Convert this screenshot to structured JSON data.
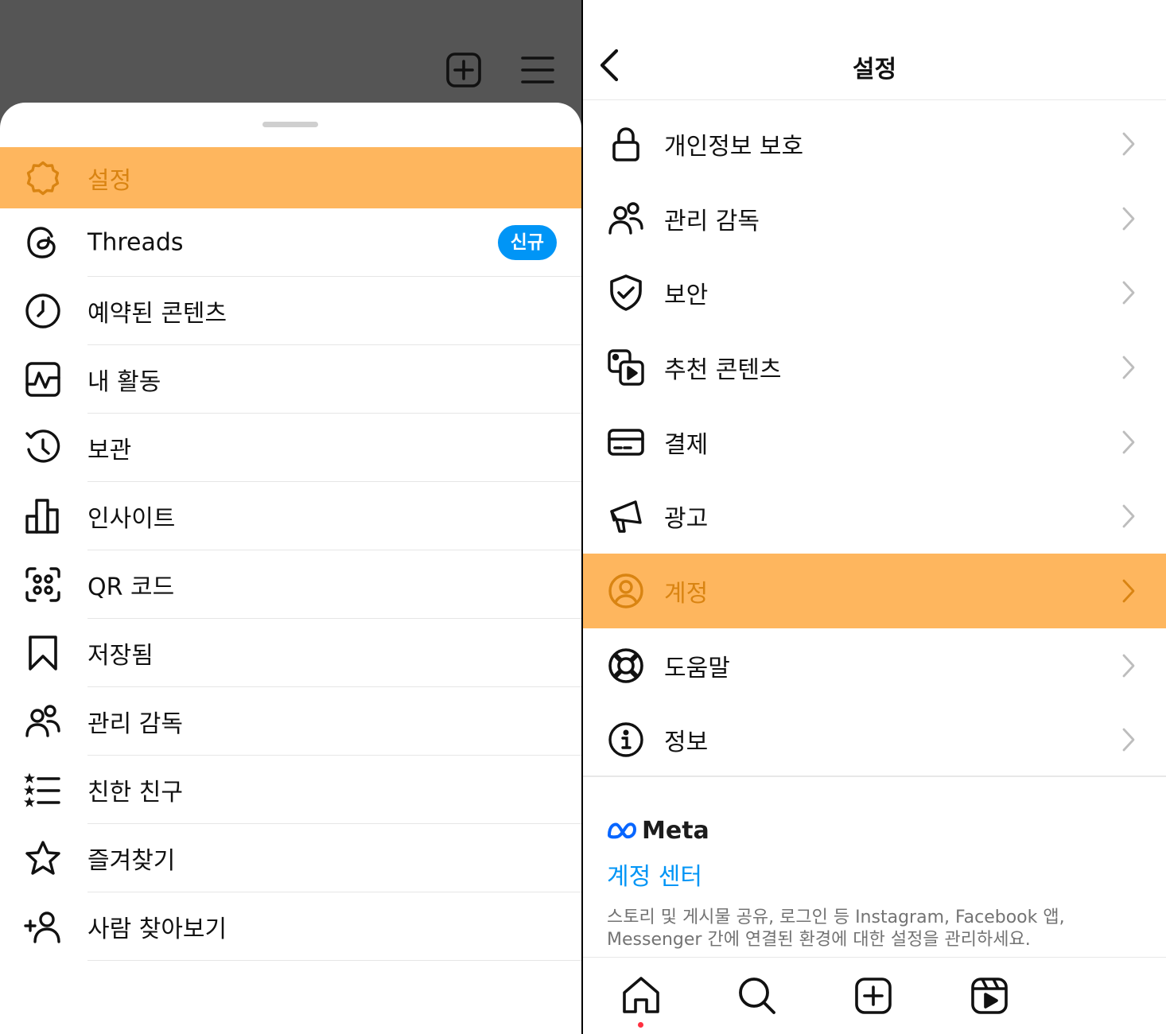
{
  "left_panel": {
    "header_icons": [
      "new-post-icon",
      "menu-icon"
    ],
    "menu": [
      {
        "label": "설정",
        "icon": "settings-icon",
        "highlighted": true
      },
      {
        "label": "Threads",
        "icon": "threads-icon",
        "badge": "신규"
      },
      {
        "label": "예약된 콘텐츠",
        "icon": "clock-icon"
      },
      {
        "label": "내 활동",
        "icon": "activity-icon"
      },
      {
        "label": "보관",
        "icon": "archive-icon"
      },
      {
        "label": "인사이트",
        "icon": "insights-icon"
      },
      {
        "label": "QR 코드",
        "icon": "qr-code-icon"
      },
      {
        "label": "저장됨",
        "icon": "bookmark-icon"
      },
      {
        "label": "관리 감독",
        "icon": "supervision-icon"
      },
      {
        "label": "친한 친구",
        "icon": "close-friends-icon"
      },
      {
        "label": "즐겨찾기",
        "icon": "star-icon"
      },
      {
        "label": "사람 찾아보기",
        "icon": "add-person-icon"
      }
    ]
  },
  "right_panel": {
    "title": "설정",
    "items": [
      {
        "label": "개인정보 보호",
        "icon": "lock-icon"
      },
      {
        "label": "관리 감독",
        "icon": "supervision-icon"
      },
      {
        "label": "보안",
        "icon": "shield-check-icon"
      },
      {
        "label": "추천 콘텐츠",
        "icon": "suggested-content-icon"
      },
      {
        "label": "결제",
        "icon": "card-icon"
      },
      {
        "label": "광고",
        "icon": "megaphone-icon"
      },
      {
        "label": "계정",
        "icon": "account-icon",
        "highlighted": true
      },
      {
        "label": "도움말",
        "icon": "lifebuoy-icon"
      },
      {
        "label": "정보",
        "icon": "info-icon"
      }
    ],
    "meta": {
      "logo_text": "Meta",
      "accounts_center": "계정 센터",
      "description": "스토리 및 게시물 공유, 로그인 등 Instagram, Facebook 앱, Messenger 간에 연결된 환경에 대한 설정을 관리하세요."
    },
    "bottom_tabs": [
      "home-icon",
      "search-icon",
      "create-icon",
      "reels-icon"
    ]
  },
  "colors": {
    "highlight_bg": "#FEB65E",
    "highlight_fg": "#D98412",
    "link_blue": "#0095F6",
    "badge_bg": "#0095F6",
    "notification_dot": "#FF3040",
    "dimmed_bg": "#555555"
  }
}
